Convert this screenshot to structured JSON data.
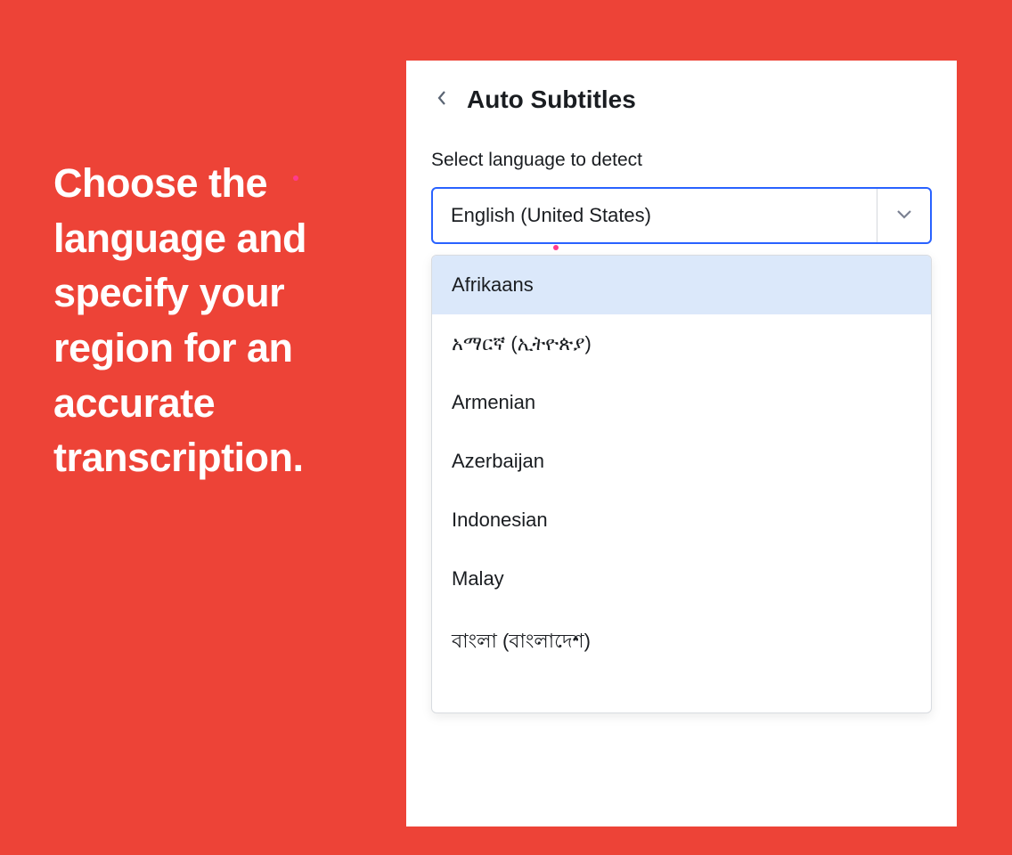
{
  "instruction": "Choose the language and specify your region for an accurate transcription.",
  "panel": {
    "title": "Auto Subtitles",
    "field_label": "Select language to detect",
    "selected_value": "English (United States)",
    "dropdown_options": [
      "Afrikaans",
      "አማርኛ (ኢትዮጵያ)",
      "Armenian",
      "Azerbaijan",
      "Indonesian",
      "Malay",
      "বাংলা (বাংলাদেশ)"
    ],
    "highlighted_index": 0
  }
}
